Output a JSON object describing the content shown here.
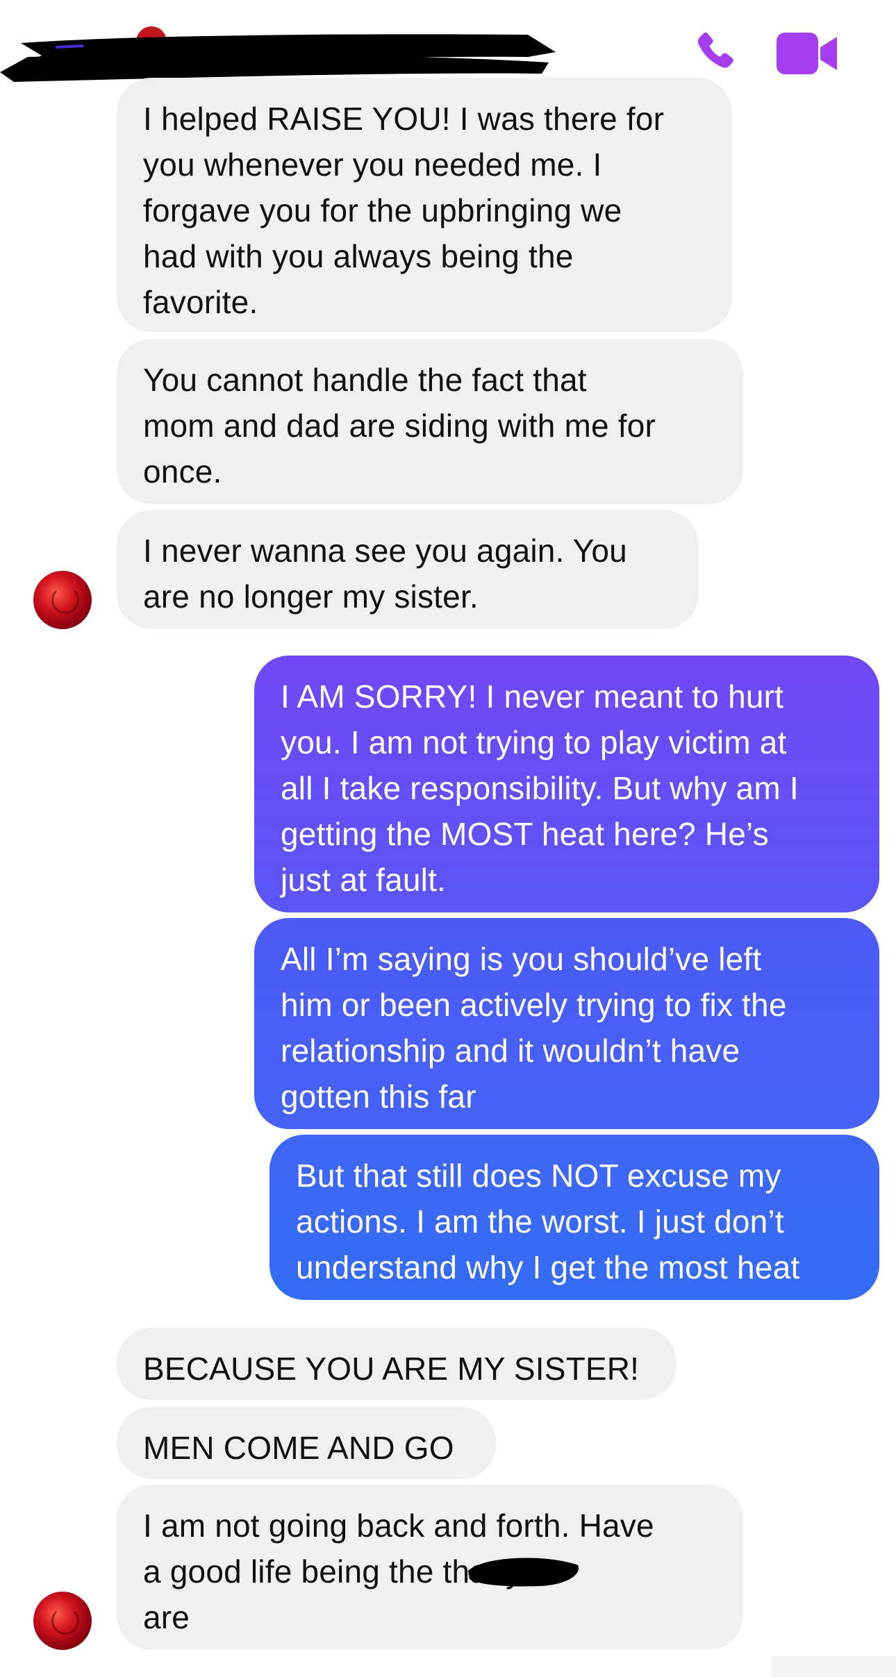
{
  "header": {
    "call_icon": "phone-icon",
    "video_icon": "video-camera-icon",
    "accent_color": "#a63ef0"
  },
  "messages": [
    {
      "from": "them",
      "text": "I helped RAISE YOU! I was there for\nyou whenever you needed me. I\nforgave you for the upbringing we\nhad with you always being the\nfavorite."
    },
    {
      "from": "them",
      "text": "You cannot handle the fact that\nmom and dad are siding with me for\nonce."
    },
    {
      "from": "them",
      "text": "I never wanna see you again. You\nare no longer my sister."
    },
    {
      "from": "me",
      "text": "I AM SORRY! I never meant to hurt\nyou. I am not trying to play victim at\nall I take responsibility. But why am I\ngetting the MOST heat here? He’s\njust at fault."
    },
    {
      "from": "me",
      "text": "All I’m saying is you should’ve left\nhim or been actively trying to fix the\nrelationship and it wouldn’t have\ngotten this far"
    },
    {
      "from": "me",
      "text": "But that still does NOT excuse my\nactions. I am the worst. I just don’t\nunderstand why I get the most heat"
    },
    {
      "from": "them",
      "text": "BECAUSE YOU ARE MY SISTER!"
    },
    {
      "from": "them",
      "text": "MEN COME AND GO"
    },
    {
      "from": "them",
      "text": "I am not going back and forth. Have\na good life being the              that you\nare"
    }
  ],
  "colors": {
    "incoming_bg": "#f0f0f0",
    "outgoing_gradient_top": "#7a4cf6",
    "outgoing_gradient_bottom": "#2f6bf5"
  }
}
